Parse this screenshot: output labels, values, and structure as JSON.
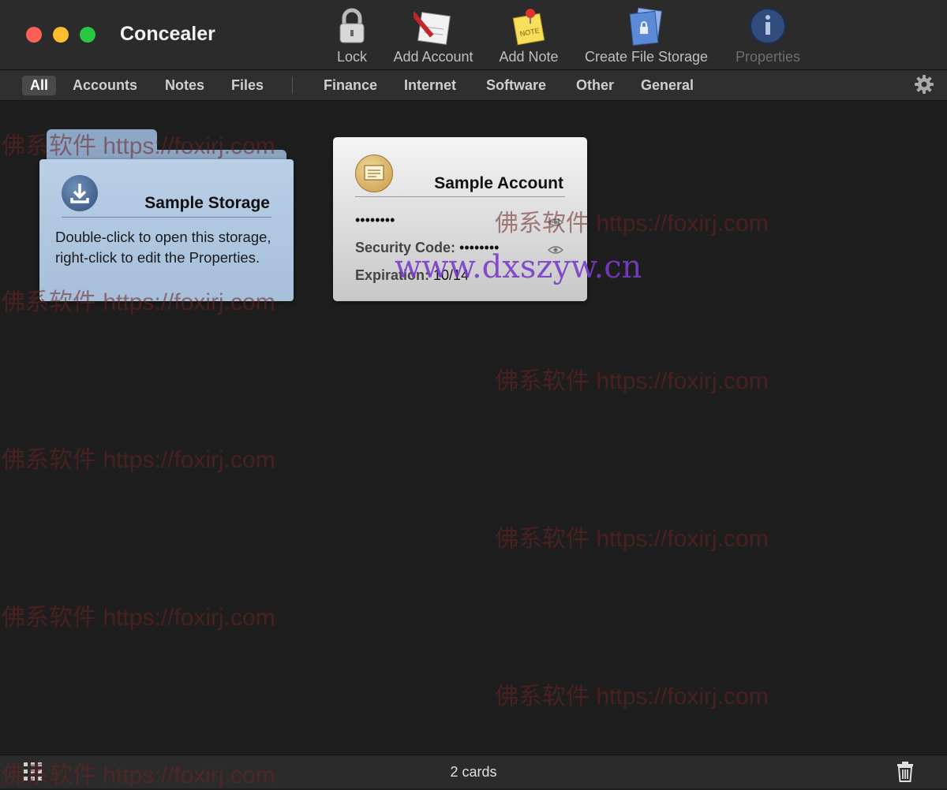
{
  "app": {
    "title": "Concealer"
  },
  "toolbar": [
    {
      "label": "Lock",
      "icon": "lock-icon",
      "enabled": true
    },
    {
      "label": "Add Account",
      "icon": "add-account-icon",
      "enabled": true
    },
    {
      "label": "Add Note",
      "icon": "add-note-icon",
      "enabled": true
    },
    {
      "label": "Create File Storage",
      "icon": "create-file-storage-icon",
      "enabled": true
    },
    {
      "label": "Properties",
      "icon": "properties-icon",
      "enabled": false
    }
  ],
  "filters": {
    "types": [
      "All",
      "Accounts",
      "Notes",
      "Files"
    ],
    "selected": "All",
    "categories": [
      "Finance",
      "Internet",
      "Software",
      "Other",
      "General"
    ]
  },
  "cards": {
    "storage": {
      "title": "Sample Storage",
      "description": "Double-click to open this storage, right-click to edit the Properties."
    },
    "account": {
      "title": "Sample Account",
      "password": "••••••••",
      "security_label": "Security Code:",
      "security_value": "••••••••",
      "expiration_label": "Expiration:",
      "expiration_value": "10/14"
    }
  },
  "status": {
    "count_text": "2 cards"
  },
  "watermarks": {
    "foxirj": "佛系软件 https://foxirj.com",
    "dxszyw": "www.dxszyw.cn"
  },
  "colors": {
    "close": "#fe5f57",
    "minimize": "#febc2e",
    "maximize": "#28c840"
  }
}
